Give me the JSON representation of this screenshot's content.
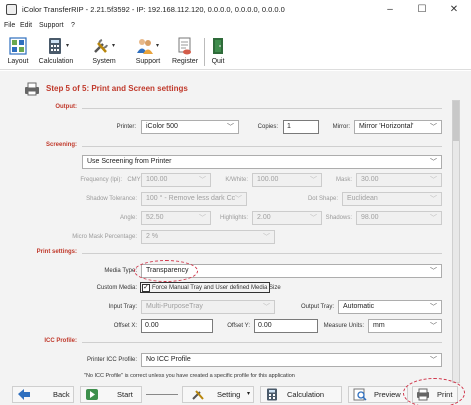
{
  "window": {
    "title": "iColor TransferRIP - 2.21.5f3592 - IP: 192.168.112.120, 0.0.0.0, 0.0.0.0, 0.0.0.0",
    "minimize": "–",
    "maximize": "☐",
    "close": "✕"
  },
  "menu": [
    "File",
    "Edit",
    "Support",
    "?"
  ],
  "toolbar": {
    "layout": "Layout",
    "calculation": "Calculation",
    "system": "System",
    "support": "Support",
    "register": "Register",
    "quit": "Quit"
  },
  "step_title": "Step 5 of 5: Print and Screen settings",
  "output": {
    "section": "Output:",
    "printer_label": "Printer:",
    "printer_value": "iColor 500",
    "copies_label": "Copies:",
    "copies_value": "1",
    "mirror_label": "Mirror:",
    "mirror_value": "Mirror 'Horizontal'"
  },
  "screening": {
    "section": "Screening:",
    "mode": "Use Screening from Printer",
    "frequency_label": "Frequency (lpi):",
    "cmy_label": "CMY:",
    "cmy_value": "100.00",
    "kwhite_label": "K/White:",
    "kwhite_value": "100.00",
    "mask_label": "Mask:",
    "mask_value": "30.00",
    "shadow_tol_label": "Shadow Tolerance:",
    "shadow_tol_value": "100 ° - Remove less dark Cc",
    "dot_shape_label": "Dot Shape:",
    "dot_shape_value": "Euclidean",
    "angle_label": "Angle:",
    "angle_value": "52.50",
    "highlights_label": "Highlights:",
    "highlights_value": "2.00",
    "shadows_label": "Shadows:",
    "shadows_value": "98.00",
    "micro_mask_label": "Micro Mask Percentage:",
    "micro_mask_value": "2 %"
  },
  "print_settings": {
    "section": "Print settings:",
    "media_type_label": "Media Type:",
    "media_type_value": "Transparency",
    "custom_media_label": "Custom Media:",
    "force_manual_label": "Force Manual Tray and User defined Media Size",
    "force_manual_checked": "✓",
    "input_tray_label": "Input Tray:",
    "input_tray_value": "Multi-PurposeTray",
    "output_tray_label": "Output Tray:",
    "output_tray_value": "Automatic",
    "offset_x_label": "Offset X:",
    "offset_x_value": "0.00",
    "offset_y_label": "Offset Y:",
    "offset_y_value": "0.00",
    "measure_units_label": "Measure Units:",
    "measure_units_value": "mm"
  },
  "icc": {
    "section": "ICC Profile:",
    "printer_icc_label": "Printer ICC Profile:",
    "printer_icc_value": "No ICC Profile",
    "note": "\"No ICC Profile\" is correct unless you have created a specific profile for this application"
  },
  "buttons": {
    "back": "Back",
    "start": "Start",
    "setting": "Setting",
    "calculation": "Calculation",
    "preview": "Preview",
    "print": "Print"
  },
  "colors": {
    "accent_red": "#c0392b",
    "highlight_ring": "#d0354a"
  }
}
